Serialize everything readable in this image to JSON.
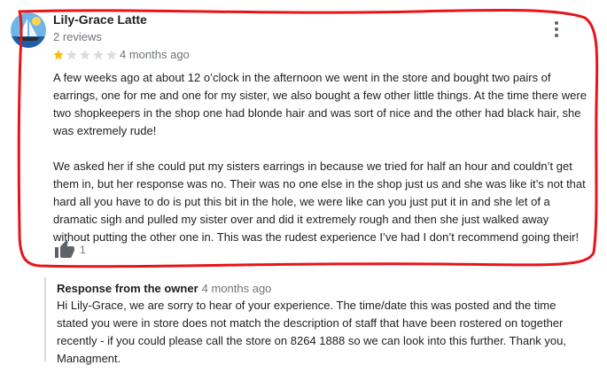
{
  "review": {
    "reviewer_name": "Lily-Grace Latte",
    "review_count": "2 reviews",
    "rating": 1,
    "max_rating": 5,
    "date": "4 months ago",
    "paragraphs": [
      "A few weeks ago at about 12 o’clock in the afternoon we went in the store and bought two pairs of earrings, one for me and one for my sister, we also bought a few other little things. At the time there were two shopkeepers in the shop one had blonde hair and was sort of nice and the other had black hair, she was extremely rude!",
      "We asked her if she could put my sisters earrings in because we tried for half an hour and couldn’t get them in, but her response was no. Their was no one else in the shop just us and she was like it’s not that hard all you have to do is put this bit in the hole, we were like can you just put it in and she let of a dramatic sigh and pulled my sister over and did it extremely rough and then she just walked away without putting the other one in. This was the rudest experience I’ve had I don’t recommend going their!"
    ],
    "likes": "1"
  },
  "owner_response": {
    "label": "Response from the owner",
    "date": "4 months ago",
    "text": "Hi Lily-Grace, we are sorry to hear of your experience. The time/date this was posted and the time stated you were in store does not match the description of staff that have been rostered on together recently - if you could please call the store on 8264 1888 so we can look into this further. Thank you, Managment."
  },
  "icons": {
    "avatar": "sailboat-avatar",
    "more": "more-vert-icon",
    "like": "thumb-up-icon",
    "star": "star-icon"
  },
  "colors": {
    "star_filled": "#fbbc04",
    "star_empty": "#dadce0",
    "highlight": "#e8141b",
    "secondary_text": "#70757a",
    "response_border": "#dadce0"
  }
}
